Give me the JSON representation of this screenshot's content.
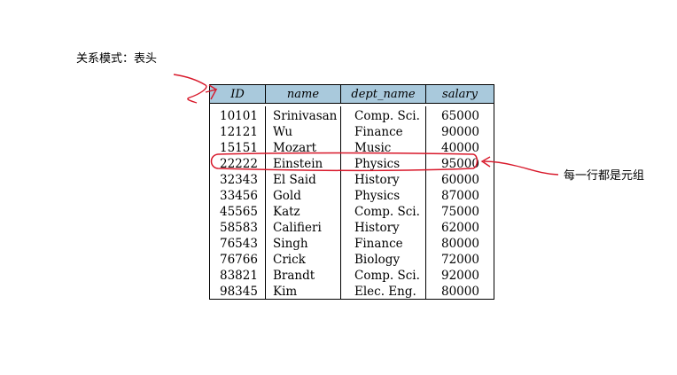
{
  "annotations": {
    "header_note": "关系模式：表头",
    "row_note": "每一行都是元组"
  },
  "table": {
    "columns": [
      "ID",
      "name",
      "dept_name",
      "salary"
    ],
    "rows": [
      [
        "10101",
        "Srinivasan",
        "Comp. Sci.",
        "65000"
      ],
      [
        "12121",
        "Wu",
        "Finance",
        "90000"
      ],
      [
        "15151",
        "Mozart",
        "Music",
        "40000"
      ],
      [
        "22222",
        "Einstein",
        "Physics",
        "95000"
      ],
      [
        "32343",
        "El Said",
        "History",
        "60000"
      ],
      [
        "33456",
        "Gold",
        "Physics",
        "87000"
      ],
      [
        "45565",
        "Katz",
        "Comp. Sci.",
        "75000"
      ],
      [
        "58583",
        "Califieri",
        "History",
        "62000"
      ],
      [
        "76543",
        "Singh",
        "Finance",
        "80000"
      ],
      [
        "76766",
        "Crick",
        "Biology",
        "72000"
      ],
      [
        "83821",
        "Brandt",
        "Comp. Sci.",
        "92000"
      ],
      [
        "98345",
        "Kim",
        "Elec. Eng.",
        "80000"
      ]
    ],
    "header_bg": "#a9c9dc"
  },
  "colors": {
    "annotation_ink": "#d8182a"
  }
}
